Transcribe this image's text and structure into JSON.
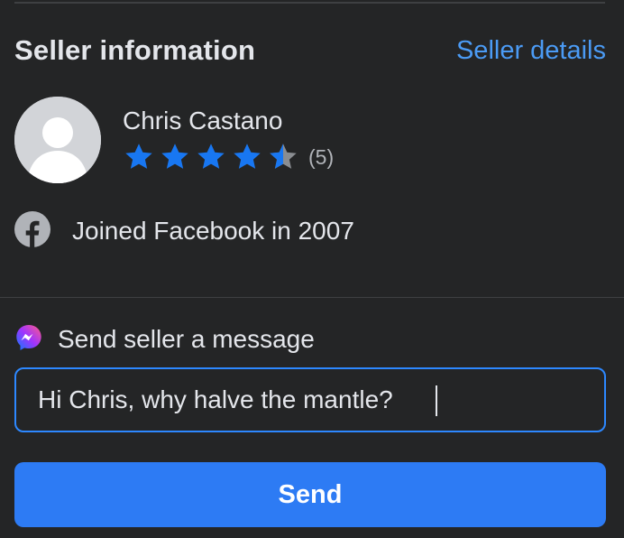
{
  "section": {
    "title": "Seller information",
    "details_link": "Seller details"
  },
  "seller": {
    "name": "Chris Castano",
    "rating": 4.5,
    "rating_max": 5,
    "rating_count_label": "(5)",
    "joined_text": "Joined Facebook in 2007"
  },
  "message": {
    "label": "Send seller a message",
    "input_value": "Hi Chris, why halve the mantle?"
  },
  "send": {
    "label": "Send"
  },
  "colors": {
    "background": "#242526",
    "accent": "#2d7bf4",
    "link": "#4b9bf5",
    "star_filled": "#1877f2",
    "star_empty": "#8a8d91"
  },
  "icons": {
    "facebook": "facebook-icon",
    "messenger": "messenger-icon",
    "avatar": "default-avatar-icon",
    "star": "star-icon"
  }
}
